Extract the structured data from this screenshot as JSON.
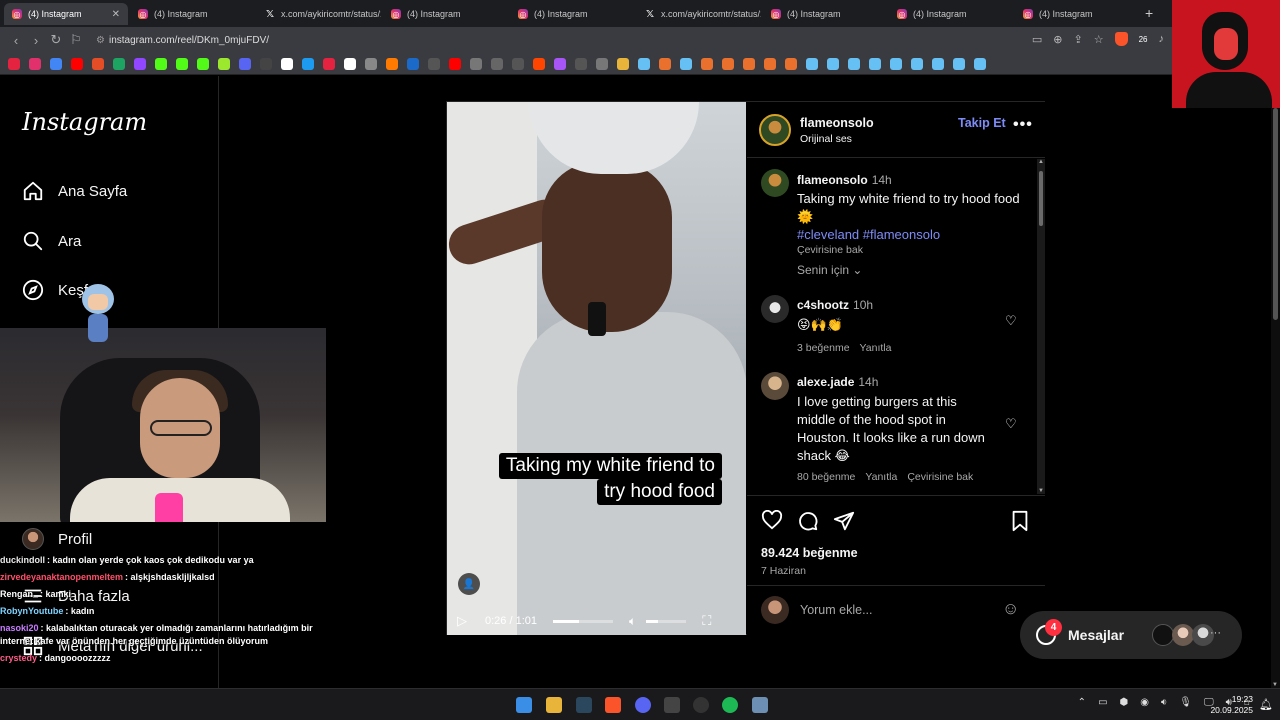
{
  "browser": {
    "tabs": [
      {
        "title": "(4) Instagram",
        "icon": "instagram",
        "active": true
      },
      {
        "title": "(4) Instagram",
        "icon": "instagram"
      },
      {
        "title": "x.com/aykiricomtr/status/1...",
        "icon": "x"
      },
      {
        "title": "(4) Instagram",
        "icon": "instagram"
      },
      {
        "title": "(4) Instagram",
        "icon": "instagram"
      },
      {
        "title": "x.com/aykiricomtr/status/1...",
        "icon": "x"
      },
      {
        "title": "(4) Instagram",
        "icon": "instagram"
      },
      {
        "title": "(4) Instagram",
        "icon": "instagram"
      },
      {
        "title": "(4) Instagram",
        "icon": "instagram"
      }
    ],
    "new_tab": "+",
    "url": "instagram.com/reel/DKm_0mjuFDV/",
    "shield_count": "26"
  },
  "sidebar": {
    "logo": "Instagram",
    "items": [
      {
        "label": "Ana Sayfa",
        "icon": "home-icon"
      },
      {
        "label": "Ara",
        "icon": "search-icon"
      },
      {
        "label": "Keşfet",
        "icon": "compass-icon"
      },
      {
        "label": "Profil",
        "icon": "profile-avatar"
      },
      {
        "label": "Daha fazla",
        "icon": "menu-icon"
      },
      {
        "label": "Meta'nın diğer ürünl...",
        "icon": "apps-icon"
      }
    ]
  },
  "chat": {
    "lines": [
      {
        "user": "duckindoll",
        "color": "#e8e8e8",
        "text": ": kadın olan yerde çok kaos çok dedikodu var ya"
      },
      {
        "user": "zirvedeyanaktanopenmeltem",
        "color": "#ff4f6b",
        "text": ": alşkjshdaskljljkalsd"
      },
      {
        "user": "Rengan_",
        "color": "#ffffff",
        "text": ": kamki"
      },
      {
        "user": "RobynYoutube",
        "color": "#7fd3ff",
        "text": ": kadın"
      },
      {
        "user": "nasoki20",
        "color": "#c77dff",
        "text": ": kalabalıktan oturacak yer olmadığı zamanlarını hatırladığım bir internet kafe var önünden her geçtiğimde üzüntüden ölüyorum"
      },
      {
        "user": "crystedy",
        "color": "#ff5c8a",
        "text": ": dangoooozzzzz"
      }
    ]
  },
  "post": {
    "video": {
      "subtitle_line1": "Taking my white friend to",
      "subtitle_line2": "try hood food",
      "time": "0:26 / 1:01",
      "progress": 0.43,
      "volume": 0.3
    },
    "header": {
      "username": "flameonsolo",
      "audio": "Orijinal ses",
      "follow": "Takip Et",
      "more": "•••"
    },
    "caption": {
      "username": "flameonsolo",
      "time": "14h",
      "text": "Taking my white friend to try hood food 🌞",
      "hashtags": "#cleveland #flameonsolo",
      "translate": "Çevirisine bak",
      "sort": "Senin için"
    },
    "comments": [
      {
        "username": "c4shootz",
        "time": "10h",
        "text": "😝🙌👏",
        "likes": "3 beğenme",
        "reply": "Yanıtla"
      },
      {
        "username": "alexe.jade",
        "time": "14h",
        "text": "I love getting burgers at this middle of the hood spot in Houston. It looks like a run down shack 😂",
        "likes": "80 beğenme",
        "reply": "Yanıtla",
        "translate": "Çevirisine bak"
      }
    ],
    "likes": "89.424 beğenme",
    "date": "7 Haziran",
    "add_comment_placeholder": "Yorum ekle..."
  },
  "messages": {
    "label": "Mesajlar",
    "badge": "4"
  },
  "taskbar": {
    "time": "19:23",
    "date": "20.09.2025"
  },
  "colors": {
    "accent_follow": "#7e8cf7",
    "hashtag": "#7e8cf7",
    "badge": "#ff3040"
  }
}
